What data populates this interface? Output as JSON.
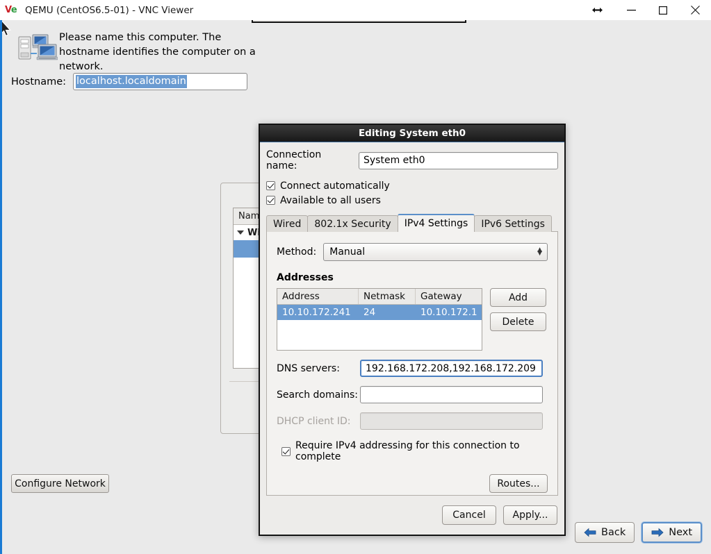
{
  "window": {
    "title": "QEMU (CentOS6.5-01) - VNC Viewer",
    "logo_left": "V",
    "logo_right": "e",
    "controls": {
      "resize": "resize-icon",
      "minimize": "minimize-icon",
      "maximize": "maximize-icon",
      "close": "close-icon"
    }
  },
  "hostname_panel": {
    "icon": "computer-network-icon",
    "description": "Please name this computer.  The hostname identifies the computer on a network.",
    "label": "Hostname:",
    "value": "localhost.localdomain"
  },
  "background_window": {
    "column_header": "Name",
    "group_row": "Wi"
  },
  "dialog": {
    "title": "Editing System eth0",
    "connection_name_label": "Connection name:",
    "connection_name_value": "System eth0",
    "checkboxes": [
      {
        "label": "Connect automatically",
        "checked": true
      },
      {
        "label": "Available to all users",
        "checked": true
      }
    ],
    "tabs": [
      {
        "label": "Wired",
        "active": false
      },
      {
        "label": "802.1x Security",
        "active": false
      },
      {
        "label": "IPv4 Settings",
        "active": true
      },
      {
        "label": "IPv6 Settings",
        "active": false
      }
    ],
    "ipv4": {
      "method_label": "Method:",
      "method_value": "Manual",
      "addresses_title": "Addresses",
      "table": {
        "columns": [
          "Address",
          "Netmask",
          "Gateway"
        ],
        "rows": [
          {
            "address": "10.10.172.241",
            "netmask": "24",
            "gateway": "10.10.172.1",
            "selected": true
          }
        ]
      },
      "add_button": "Add",
      "delete_button": "Delete",
      "dns_label": "DNS servers:",
      "dns_value": "192.168.172.208,192.168.172.209",
      "dns_placeholder": "",
      "search_label": "Search domains:",
      "search_value": "",
      "search_placeholder": "",
      "dhcp_label": "DHCP client ID:",
      "dhcp_value": "",
      "dhcp_placeholder": "",
      "require_label": "Require IPv4 addressing for this connection to complete",
      "require_checked": true,
      "routes_button": "Routes..."
    },
    "cancel_button": "Cancel",
    "apply_button": "Apply..."
  },
  "footer": {
    "configure_network": "Configure Network",
    "back_button": "Back",
    "next_button": "Next"
  },
  "colors": {
    "accent_blue": "#1a7bd4",
    "selection_blue": "#6a9bd1",
    "focus_blue": "#4a7fc1",
    "titlebar_dark": "#2b2b2b",
    "panel_bg": "#edecea",
    "screen_bg": "#eaeaea"
  }
}
